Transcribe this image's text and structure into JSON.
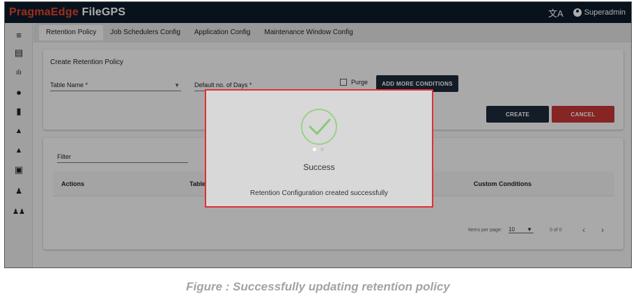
{
  "brand": {
    "part1": "PragmaEdge",
    "part2": "FileGPS"
  },
  "topbar": {
    "language_icon": "translate-icon",
    "user_icon": "account-circle-icon",
    "user_name": "Superadmin"
  },
  "sidebar": {
    "items": [
      {
        "icon": "menu-icon",
        "glyph": "≡"
      },
      {
        "icon": "files-icon",
        "glyph": "▤"
      },
      {
        "icon": "bar-chart-icon",
        "glyph": "ılı"
      },
      {
        "icon": "account-icon",
        "glyph": "●"
      },
      {
        "icon": "document-icon",
        "glyph": "▮"
      },
      {
        "icon": "alert-bell-icon",
        "glyph": "▲"
      },
      {
        "icon": "alert-bell-settings-icon",
        "glyph": "▲"
      },
      {
        "icon": "settings-box-icon",
        "glyph": "▣"
      },
      {
        "icon": "user-settings-icon",
        "glyph": "♟"
      },
      {
        "icon": "group-icon",
        "glyph": "♟♟"
      }
    ]
  },
  "tabs": [
    {
      "label": "Retention Policy",
      "active": true
    },
    {
      "label": "Job Schedulers Config",
      "active": false
    },
    {
      "label": "Application Config",
      "active": false
    },
    {
      "label": "Maintenance Window Config",
      "active": false
    }
  ],
  "form": {
    "title": "Create Retention Policy",
    "table_name_label": "Table Name *",
    "default_days_label": "Default no. of Days *",
    "purge_label": "Purge",
    "add_conditions_label": "ADD MORE CONDITIONS",
    "create_label": "CREATE",
    "cancel_label": "CANCEL"
  },
  "table": {
    "filter_label": "Filter",
    "columns": [
      "Actions",
      "Table",
      "Custom Conditions"
    ],
    "items_per_page_label": "Items per page:",
    "items_per_page_value": "10",
    "range_label": "0 of 0"
  },
  "modal": {
    "title": "Success",
    "message": "Retention Configuration created successfully",
    "icon": "check-circle-icon"
  },
  "colors": {
    "brand_red": "#e8462a",
    "header_dark": "#0d1b2a",
    "cancel_red": "#c83535",
    "success_green": "#8bc77a",
    "highlight_red": "#e03030"
  },
  "caption": "Figure : Successfully updating retention policy"
}
